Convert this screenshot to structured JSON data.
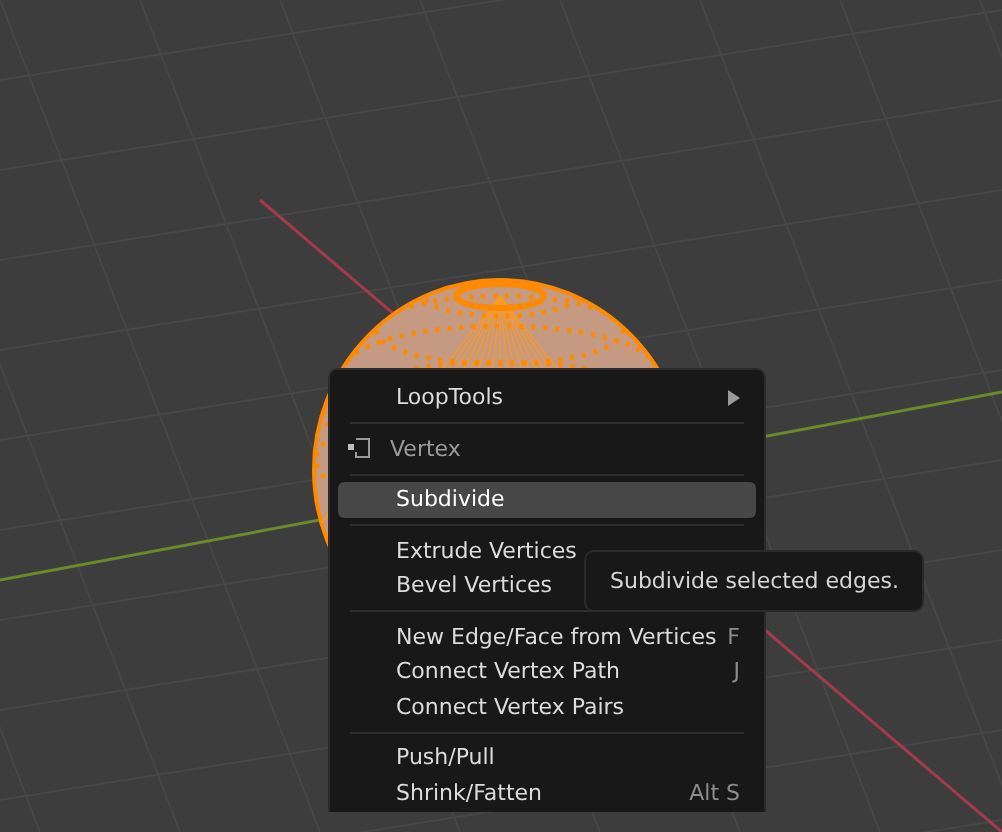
{
  "menu": {
    "items": [
      {
        "kind": "submenu",
        "label": "LoopTools",
        "selected": false
      },
      {
        "kind": "separator"
      },
      {
        "kind": "header",
        "label": "Vertex"
      },
      {
        "kind": "separator"
      },
      {
        "kind": "item",
        "label": "Subdivide",
        "selected": true
      },
      {
        "kind": "separator"
      },
      {
        "kind": "item",
        "label": "Extrude Vertices",
        "selected": false
      },
      {
        "kind": "item",
        "label": "Bevel Vertices",
        "selected": false
      },
      {
        "kind": "separator"
      },
      {
        "kind": "item",
        "label": "New Edge/Face from Vertices",
        "shortcut": "F",
        "selected": false
      },
      {
        "kind": "item",
        "label": "Connect Vertex Path",
        "shortcut": "J",
        "selected": false
      },
      {
        "kind": "item",
        "label": "Connect Vertex Pairs",
        "selected": false
      },
      {
        "kind": "separator"
      },
      {
        "kind": "item",
        "label": "Push/Pull",
        "selected": false
      },
      {
        "kind": "item",
        "label": "Shrink/Fatten",
        "shortcut": "Alt S",
        "selected": false
      }
    ]
  },
  "tooltip": {
    "text": "Subdivide selected edges."
  }
}
